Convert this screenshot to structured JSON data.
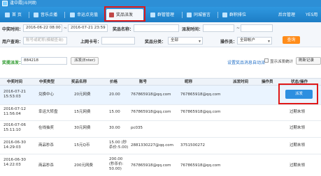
{
  "window": {
    "title": "逢中霞|斗同助"
  },
  "nav": {
    "tabs": [
      {
        "label": "首 页"
      },
      {
        "label": "音乐点播"
      },
      {
        "label": "幸运点充值"
      },
      {
        "label": "奖品派发"
      },
      {
        "label": "群管管理"
      },
      {
        "label": "同城留言"
      },
      {
        "label": "群积排位"
      }
    ],
    "right_label": "后台管理",
    "right_label2": "YES用"
  },
  "filters": {
    "win_time_label": "中奖时间：",
    "win_time_start": "2016-06-22 08:00",
    "win_time_end": "2016-07-21 23:59",
    "range_sep": "~",
    "prize_name_label": "奖品名称：",
    "dispatch_time_label": "派发时间：",
    "dispatch_range_sep": "~",
    "user_query_label": "用户查询：",
    "user_query_placeholder": "账号或昵称(模糊查询)",
    "order_no_label": "上网卡号：",
    "prize_type_label": "奖品分类：",
    "prize_type_value": "全部",
    "operator_label": "操作员：",
    "operator_value": "全部帐户",
    "query_button": "查询"
  },
  "actions": {
    "green_label": "奖揽派发：",
    "enter_value": "884218",
    "enter_button": "派发(Enter)",
    "auto_link": "设置奖品消息自动派",
    "checkbox_label": "显示派发统计",
    "stats_button": "刷新记录"
  },
  "table": {
    "headers": [
      "中奖时间",
      "中奖类型",
      "奖品名称",
      "价格",
      "账号",
      "昵称",
      "派发时间",
      "操作员",
      "状态/操作"
    ],
    "rows": [
      {
        "time": "2016-07-21\n15:53:03",
        "type": "兑换中心",
        "prize": "20元网费",
        "price": "20.00",
        "account": "767865918@qq.com",
        "nick": "767865918@qq.com",
        "dispatch": "",
        "operator": "",
        "status": "",
        "action": "派发"
      },
      {
        "time": "2016-07-12\n11:56:04",
        "type": "幸运大转盘",
        "prize": "15元网费",
        "price": "15.00",
        "account": "767865918@qq.com",
        "nick": "767865918@qq.com",
        "dispatch": "",
        "operator": "",
        "status": "过期未领",
        "action": ""
      },
      {
        "time": "2016-07-06\n15:11:10",
        "type": "在线抽奖",
        "prize": "30元网费",
        "price": "30.00",
        "account": "pc035",
        "nick": "",
        "dispatch": "",
        "operator": "",
        "status": "过期未领",
        "action": ""
      },
      {
        "time": "2016-06-30\n14:29:03",
        "type": "商品秒杀",
        "prize": "15元Q币",
        "price": "15.00 (秒\n杀价:5.00)",
        "account": "2881330227@qq.com",
        "nick": "3751500272",
        "dispatch": "",
        "operator": "",
        "status": "过期未领",
        "action": ""
      },
      {
        "time": "2016-06-30\n14:22:03",
        "type": "商品秒杀",
        "prize": "200元网费",
        "price": "200.00\n(秒杀价:\n50.00)",
        "account": "767865918@qq.com",
        "nick": "767865918@qq.com",
        "dispatch": "",
        "operator": "",
        "status": "过期未领",
        "action": ""
      }
    ]
  },
  "colors": {
    "nav_blue": "#2d8fd6",
    "highlight_red": "#e01818",
    "query_orange": "#ff8c1a",
    "green": "#2c9a2c",
    "link_blue": "#2471c7"
  }
}
